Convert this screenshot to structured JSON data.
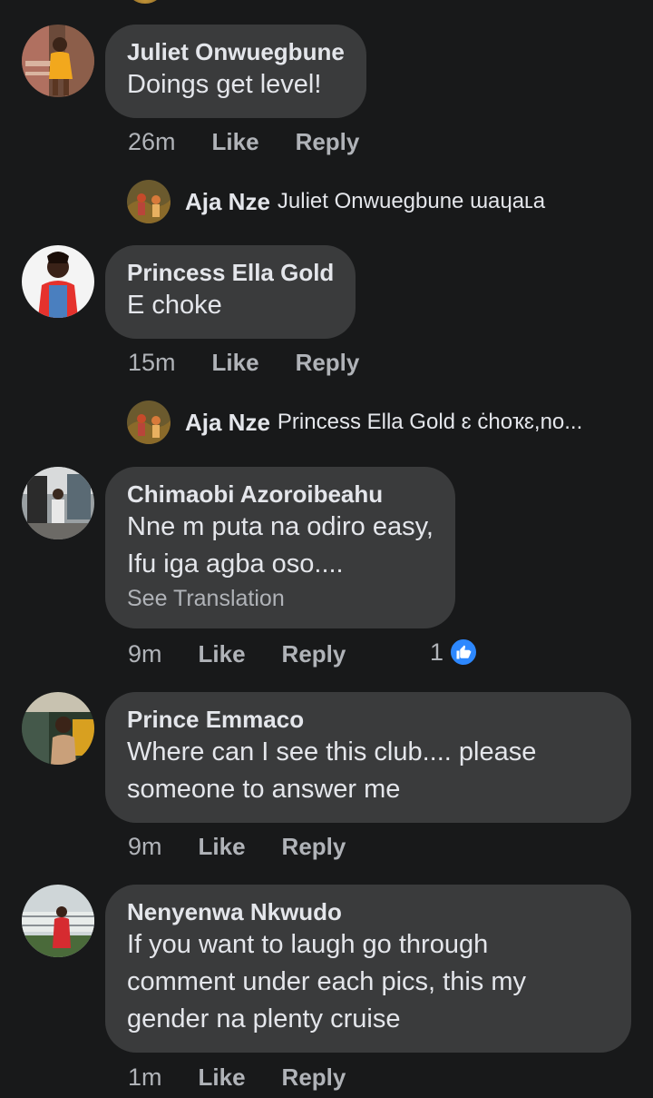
{
  "comments": [
    {
      "author": "Juliet Onwuegbune",
      "lines": [
        "Doings get level!"
      ],
      "time": "26m",
      "like_label": "Like",
      "reply_label": "Reply",
      "reply": {
        "author": "Aja Nze",
        "text": "Juliet Onwuegbune ɯaɥaʟa"
      }
    },
    {
      "author": "Princess Ella Gold",
      "lines": [
        "E choke"
      ],
      "time": "15m",
      "like_label": "Like",
      "reply_label": "Reply",
      "reply": {
        "author": "Aja Nze",
        "text": "Princess Ella Gold ɛ ċhoҡɛ,no..."
      }
    },
    {
      "author": "Chimaobi Azoroibeahu",
      "lines": [
        "Nne m puta na odiro easy,",
        "Ifu iga agba oso...."
      ],
      "see_translation": "See Translation",
      "time": "9m",
      "like_label": "Like",
      "reply_label": "Reply",
      "reaction_count": "1",
      "reaction_icon": "thumbs-up-icon"
    },
    {
      "author": "Prince Emmaco",
      "lines": [
        "Where can I see this club.... please",
        "someone to answer me"
      ],
      "time": "9m",
      "like_label": "Like",
      "reply_label": "Reply"
    },
    {
      "author": "Nenyenwa Nkwudo",
      "lines": [
        "If you want to laugh go through",
        "comment under each pics, this my",
        "gender na plenty  cruise"
      ],
      "time": "1m",
      "like_label": "Like",
      "reply_label": "Reply"
    }
  ],
  "colors": {
    "background": "#18191a",
    "bubble": "#3a3b3c",
    "primary_text": "#e4e6eb",
    "secondary_text": "#b0b3b8",
    "like_blue": "#2d88ff"
  }
}
